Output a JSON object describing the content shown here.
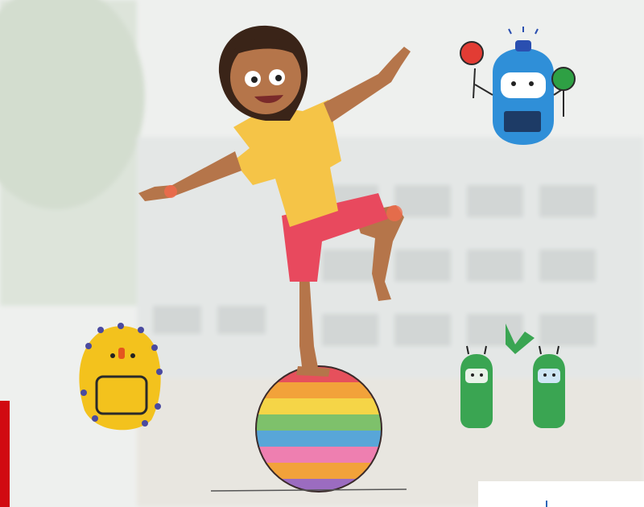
{
  "scene": {
    "subject": "girl-balancing-on-ball",
    "colors": {
      "shirt": "#f5c447",
      "shorts": "#e8495e",
      "skin": "#b5754a",
      "hair": "#3a2418",
      "yellow_robot": "#f3c21d",
      "blue_robot": "#2f8fd8",
      "green_robots": "#3aa552",
      "accent_red": "#d10a11"
    },
    "ball_stripes": [
      "#e6505c",
      "#f2a23a",
      "#f5d547",
      "#7ec16b",
      "#58a6d8",
      "#9b6cc0",
      "#ee7fb0"
    ]
  }
}
